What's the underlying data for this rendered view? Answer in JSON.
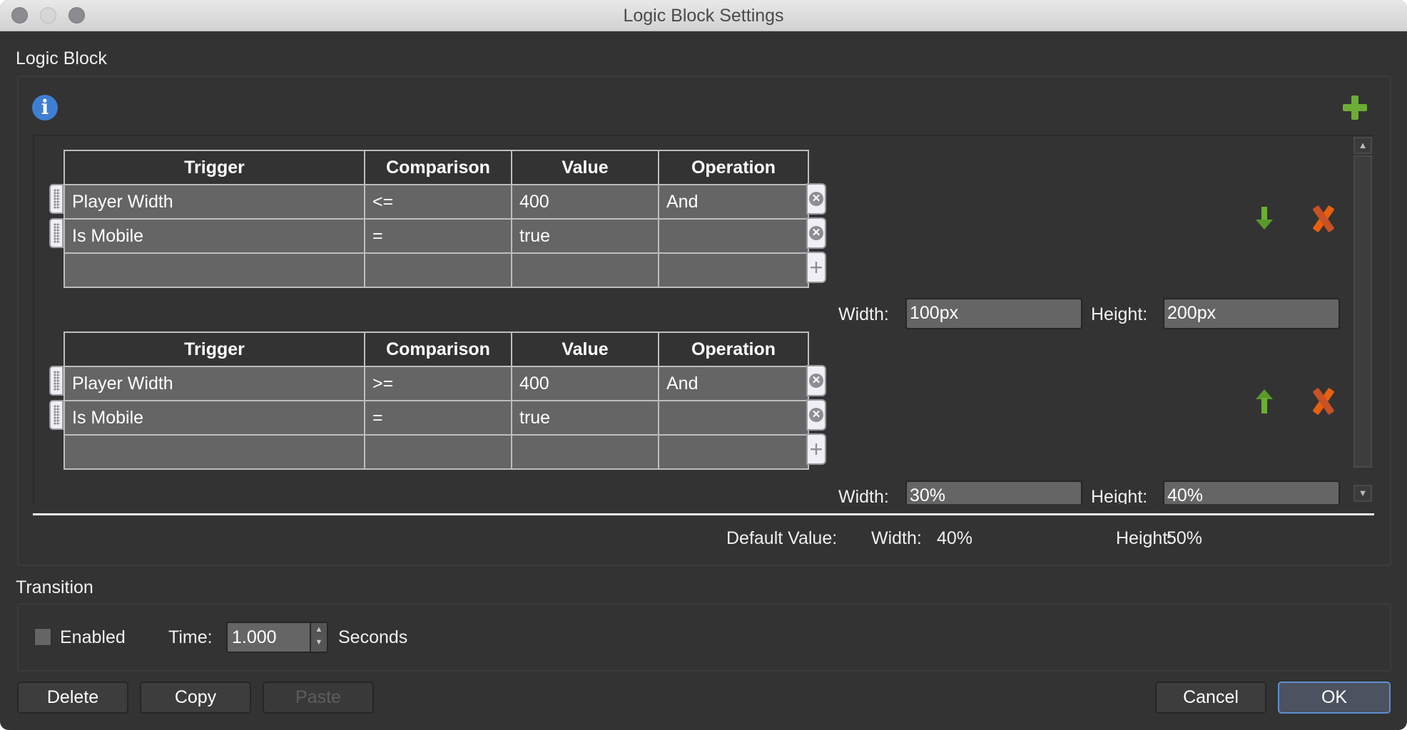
{
  "window": {
    "title": "Logic Block Settings"
  },
  "logic_block": {
    "section_label": "Logic Block",
    "columns": [
      "Trigger",
      "Comparison",
      "Value",
      "Operation"
    ],
    "blocks": [
      {
        "rows": [
          {
            "trigger": "Player Width",
            "comparison": "<=",
            "value": "400",
            "operation": "And"
          },
          {
            "trigger": "Is Mobile",
            "comparison": "=",
            "value": "true",
            "operation": ""
          }
        ],
        "width_label": "Width:",
        "width_value": "100px",
        "height_label": "Height:",
        "height_value": "200px",
        "move_icon": "arrow-down-icon"
      },
      {
        "rows": [
          {
            "trigger": "Player Width",
            "comparison": ">=",
            "value": "400",
            "operation": "And"
          },
          {
            "trigger": "Is Mobile",
            "comparison": "=",
            "value": "true",
            "operation": ""
          }
        ],
        "width_label": "Width:",
        "width_value": "30%",
        "height_label": "Height:",
        "height_value": "40%",
        "move_icon": "arrow-up-icon"
      }
    ],
    "default_value": {
      "label": "Default Value:",
      "width_label": "Width:",
      "width_value": "40%",
      "height_label": "Height:",
      "height_value": "50%"
    }
  },
  "transition": {
    "section_label": "Transition",
    "enabled_label": "Enabled",
    "enabled": false,
    "time_label": "Time:",
    "time_value": "1.000",
    "unit_label": "Seconds"
  },
  "buttons": {
    "delete": "Delete",
    "copy": "Copy",
    "paste": "Paste",
    "cancel": "Cancel",
    "ok": "OK"
  },
  "colors": {
    "add": "#6cae34",
    "remove": "#e8600e",
    "info": "#3f7fd2",
    "default_button_border": "#5f8ed0"
  }
}
